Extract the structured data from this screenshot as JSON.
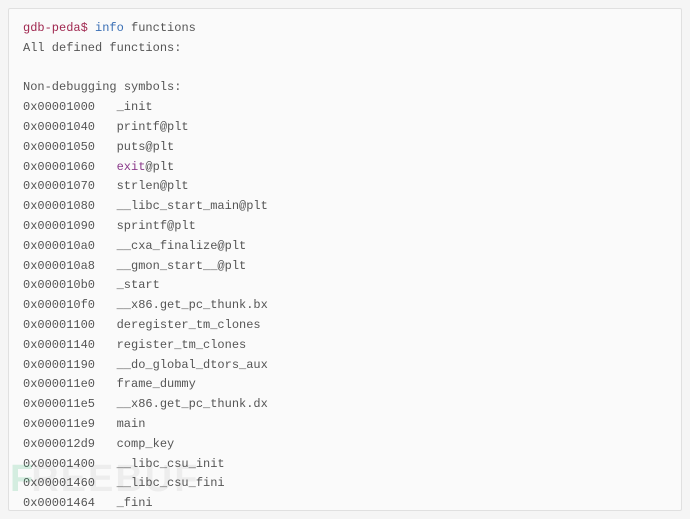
{
  "prompt": {
    "prefix": "gdb-peda",
    "dollar": "$",
    "command_keyword": "info",
    "command_arg": "functions"
  },
  "header_line": "All defined functions:",
  "section_line": "Non-debugging symbols:",
  "symbols": [
    {
      "addr": "0x00001000",
      "name": "_init"
    },
    {
      "addr": "0x00001040",
      "name": "printf@plt"
    },
    {
      "addr": "0x00001050",
      "name": "puts@plt"
    },
    {
      "addr": "0x00001060",
      "name_pre": "exit",
      "name_post": "@plt",
      "highlight": true
    },
    {
      "addr": "0x00001070",
      "name": "strlen@plt"
    },
    {
      "addr": "0x00001080",
      "name": "__libc_start_main@plt"
    },
    {
      "addr": "0x00001090",
      "name": "sprintf@plt"
    },
    {
      "addr": "0x000010a0",
      "name": "__cxa_finalize@plt"
    },
    {
      "addr": "0x000010a8",
      "name": "__gmon_start__@plt"
    },
    {
      "addr": "0x000010b0",
      "name": "_start"
    },
    {
      "addr": "0x000010f0",
      "name": "__x86.get_pc_thunk.bx"
    },
    {
      "addr": "0x00001100",
      "name": "deregister_tm_clones"
    },
    {
      "addr": "0x00001140",
      "name": "register_tm_clones"
    },
    {
      "addr": "0x00001190",
      "name": "__do_global_dtors_aux"
    },
    {
      "addr": "0x000011e0",
      "name": "frame_dummy"
    },
    {
      "addr": "0x000011e5",
      "name": "__x86.get_pc_thunk.dx"
    },
    {
      "addr": "0x000011e9",
      "name": "main"
    },
    {
      "addr": "0x000012d9",
      "name": "comp_key"
    },
    {
      "addr": "0x00001400",
      "name": "__libc_csu_init"
    },
    {
      "addr": "0x00001460",
      "name": "__libc_csu_fini"
    },
    {
      "addr": "0x00001464",
      "name": "_fini"
    }
  ],
  "watermark": {
    "accent": "F",
    "rest": "REEBUF"
  }
}
